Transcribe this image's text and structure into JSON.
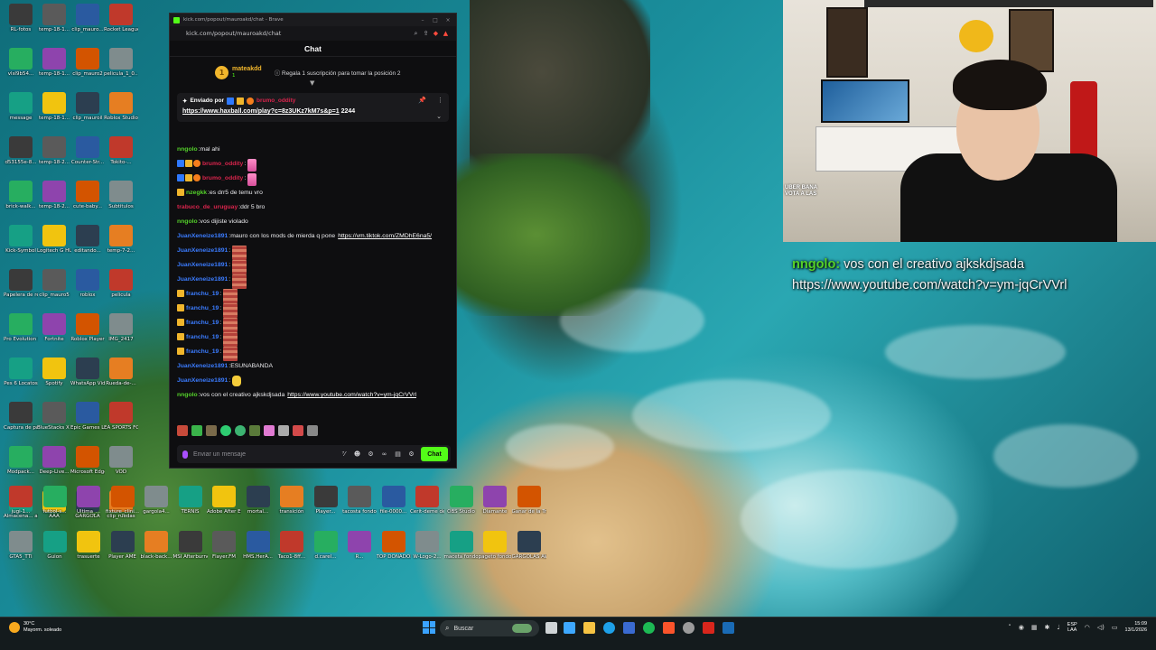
{
  "browser": {
    "title": "kick.com/popout/mauroakd/chat - Brave",
    "url": "kick.com/popout/mauroakd/chat"
  },
  "chat": {
    "header": "Chat",
    "sub_banner": {
      "rank": "1",
      "username": "mateakdd",
      "count": "1",
      "cta": "Regala 1 suscripción para tomar la posición 2"
    },
    "pinned": {
      "sent_by": "Enviado por",
      "link": "https://www.haxball.com/play?c=8z3UKz7kM7s&p=1",
      "suffix": " 2244"
    },
    "messages": [
      {
        "badges": [],
        "user": "nngolo",
        "color": "#54d12a",
        "text": "mal ahi",
        "link": "",
        "emote": ""
      },
      {
        "badges": [
          "blue",
          "gold",
          "orange"
        ],
        "user": "brumo_oddity",
        "color": "#d9244c",
        "text": "",
        "link": "",
        "emote": "pink"
      },
      {
        "badges": [
          "blue",
          "gold",
          "orange"
        ],
        "user": "brumo_oddity",
        "color": "#d9244c",
        "text": "",
        "link": "",
        "emote": "pink"
      },
      {
        "badges": [
          "gold"
        ],
        "user": "nzegkk",
        "color": "#54d12a",
        "text": "es drr5 de temu vro",
        "link": "",
        "emote": ""
      },
      {
        "badges": [],
        "user": "trabuco_de_uruguay",
        "color": "#d9244c",
        "text": "ddr 5 bro",
        "link": "",
        "emote": ""
      },
      {
        "badges": [],
        "user": "nngolo",
        "color": "#54d12a",
        "text": "vos dijiste violado",
        "link": "",
        "emote": ""
      },
      {
        "badges": [],
        "user": "JuanXeneize1891",
        "color": "#3b7cff",
        "text": "mauro con los mods de mierda q pone",
        "link": "https://vm.tiktok.com/ZMDhE6na5/",
        "emote": ""
      },
      {
        "badges": [],
        "user": "JuanXeneize1891",
        "color": "#3b7cff",
        "text": "",
        "link": "",
        "emote": "tall"
      },
      {
        "badges": [],
        "user": "JuanXeneize1891",
        "color": "#3b7cff",
        "text": "",
        "link": "",
        "emote": "tall"
      },
      {
        "badges": [],
        "user": "JuanXeneize1891",
        "color": "#3b7cff",
        "text": "",
        "link": "",
        "emote": "tall"
      },
      {
        "badges": [
          "gold"
        ],
        "user": "franchu_19",
        "color": "#3b7cff",
        "text": "",
        "link": "",
        "emote": "tall"
      },
      {
        "badges": [
          "gold"
        ],
        "user": "franchu_19",
        "color": "#3b7cff",
        "text": "",
        "link": "",
        "emote": "tall"
      },
      {
        "badges": [
          "gold"
        ],
        "user": "franchu_19",
        "color": "#3b7cff",
        "text": "",
        "link": "",
        "emote": "tall"
      },
      {
        "badges": [
          "gold"
        ],
        "user": "franchu_19",
        "color": "#3b7cff",
        "text": "",
        "link": "",
        "emote": "tall"
      },
      {
        "badges": [
          "gold"
        ],
        "user": "franchu_19",
        "color": "#3b7cff",
        "text": "",
        "link": "",
        "emote": "tall"
      },
      {
        "badges": [],
        "user": "JuanXeneize1891",
        "color": "#3b7cff",
        "text": "ESUNABANDA",
        "link": "",
        "emote": ""
      },
      {
        "badges": [],
        "user": "JuanXeneize1891",
        "color": "#3b7cff",
        "text": "",
        "link": "",
        "emote": "hand"
      },
      {
        "badges": [],
        "user": "nngolo",
        "color": "#54d12a",
        "text": "vos con el creativo ajkskdjsada",
        "link": "https://www.youtube.com/watch?v=ym-jqCrVVrl",
        "emote": ""
      }
    ],
    "input_placeholder": "Enviar un mensaje",
    "send_label": "Chat"
  },
  "webcam_overlay": {
    "line1": "UBER BANA",
    "line2": "VOTA A LAS"
  },
  "stream_overlay": {
    "user": "nngolo:",
    "text": " vos con el creativo ajkskdjsada",
    "link": "https://www.youtube.com/watch?v=ym-jqCrVVrl"
  },
  "desktop_icons": [
    {
      "label": "RL-fotos"
    },
    {
      "label": "temp-18-1..."
    },
    {
      "label": "clip_mauro..."
    },
    {
      "label": "Rocket League"
    },
    {
      "label": "vlsl9b54..."
    },
    {
      "label": "temp-18-1..."
    },
    {
      "label": "clip_mauro2"
    },
    {
      "label": "pelicula_1_0..."
    },
    {
      "label": "message"
    },
    {
      "label": "temp-18-1..."
    },
    {
      "label": "clip_mauroil"
    },
    {
      "label": "Roblox Studio"
    },
    {
      "label": "d53155e-8..."
    },
    {
      "label": "temp-18-2..."
    },
    {
      "label": "Counter-Str..."
    },
    {
      "label": "Tokito-..."
    },
    {
      "label": "brick-walk..."
    },
    {
      "label": "temp-18-2..."
    },
    {
      "label": "cute-baby..."
    },
    {
      "label": "Subtitulos"
    },
    {
      "label": "Kick-Symbol"
    },
    {
      "label": "Logitech G HUB"
    },
    {
      "label": "editando..."
    },
    {
      "label": "temp-7-2..."
    },
    {
      "label": "Papelera de reciclaje"
    },
    {
      "label": "clip_mauro5"
    },
    {
      "label": "roblox"
    },
    {
      "label": "pelicula"
    },
    {
      "label": "Pro Evolution Soccer 6"
    },
    {
      "label": "Fortnite"
    },
    {
      "label": "Roblox Player"
    },
    {
      "label": "IMG_2417"
    },
    {
      "label": "Pes 6 Locatos"
    },
    {
      "label": "Spotify"
    },
    {
      "label": "WhatsApp Video 2025-..."
    },
    {
      "label": "Rueda-de-..."
    },
    {
      "label": "Captura de pantalla"
    },
    {
      "label": "BlueStacks X Multi-Instance"
    },
    {
      "label": "Epic Games Launcher"
    },
    {
      "label": "EA SPORTS FC 26"
    },
    {
      "label": "Modpack..."
    },
    {
      "label": "Deep-Live..."
    },
    {
      "label": "Microsoft Edge"
    },
    {
      "label": "VOD"
    },
    {
      "label": "Almacena... automátic..."
    },
    {
      "label": "AAA"
    },
    {
      "label": "GARGOLA"
    },
    {
      "label": "clip_ruedas"
    }
  ],
  "bottom_icons": [
    {
      "label": "jugi-1..."
    },
    {
      "label": "futbol-s..."
    },
    {
      "label": "Ultima_..."
    },
    {
      "label": "fixture_clini..."
    },
    {
      "label": "gargola4..."
    },
    {
      "label": "TERNIS"
    },
    {
      "label": "Adobe After Effects"
    },
    {
      "label": "mortal..."
    },
    {
      "label": "transición"
    },
    {
      "label": "Player..."
    },
    {
      "label": "tacosta fondo"
    },
    {
      "label": "file-0000..."
    },
    {
      "label": "Cerit-deme de fondo"
    },
    {
      "label": "OBS Studio"
    },
    {
      "label": "Diamante"
    },
    {
      "label": "Ganar de la Trouple..."
    },
    {
      "label": "GTA5_TTI"
    },
    {
      "label": "Guion"
    },
    {
      "label": "trasuerte"
    },
    {
      "label": "Player AME"
    },
    {
      "label": "black-back..."
    },
    {
      "label": "MSI Afterburner"
    },
    {
      "label": "Flayer.FM"
    },
    {
      "label": "HMS.HerA..."
    },
    {
      "label": "Taco1-8ff..."
    },
    {
      "label": "d.carel..."
    },
    {
      "label": "R..."
    },
    {
      "label": "TOP DONADOR"
    },
    {
      "label": "W-Logo-2..."
    },
    {
      "label": "maceta fondo"
    },
    {
      "label": "pageto fondo"
    },
    {
      "label": "GARGOLAS AWARDS"
    }
  ],
  "taskbar": {
    "weather_temp": "30°C",
    "weather_desc": "Mayorm. soleado",
    "search_placeholder": "Buscar",
    "lang1": "ESP",
    "lang2": "LAA",
    "time": "15:09",
    "date": "13/1/2026"
  },
  "colors": {
    "kick_green": "#53fc18",
    "taskbar": "#141b1d",
    "chat_bg": "#0e0e10"
  }
}
